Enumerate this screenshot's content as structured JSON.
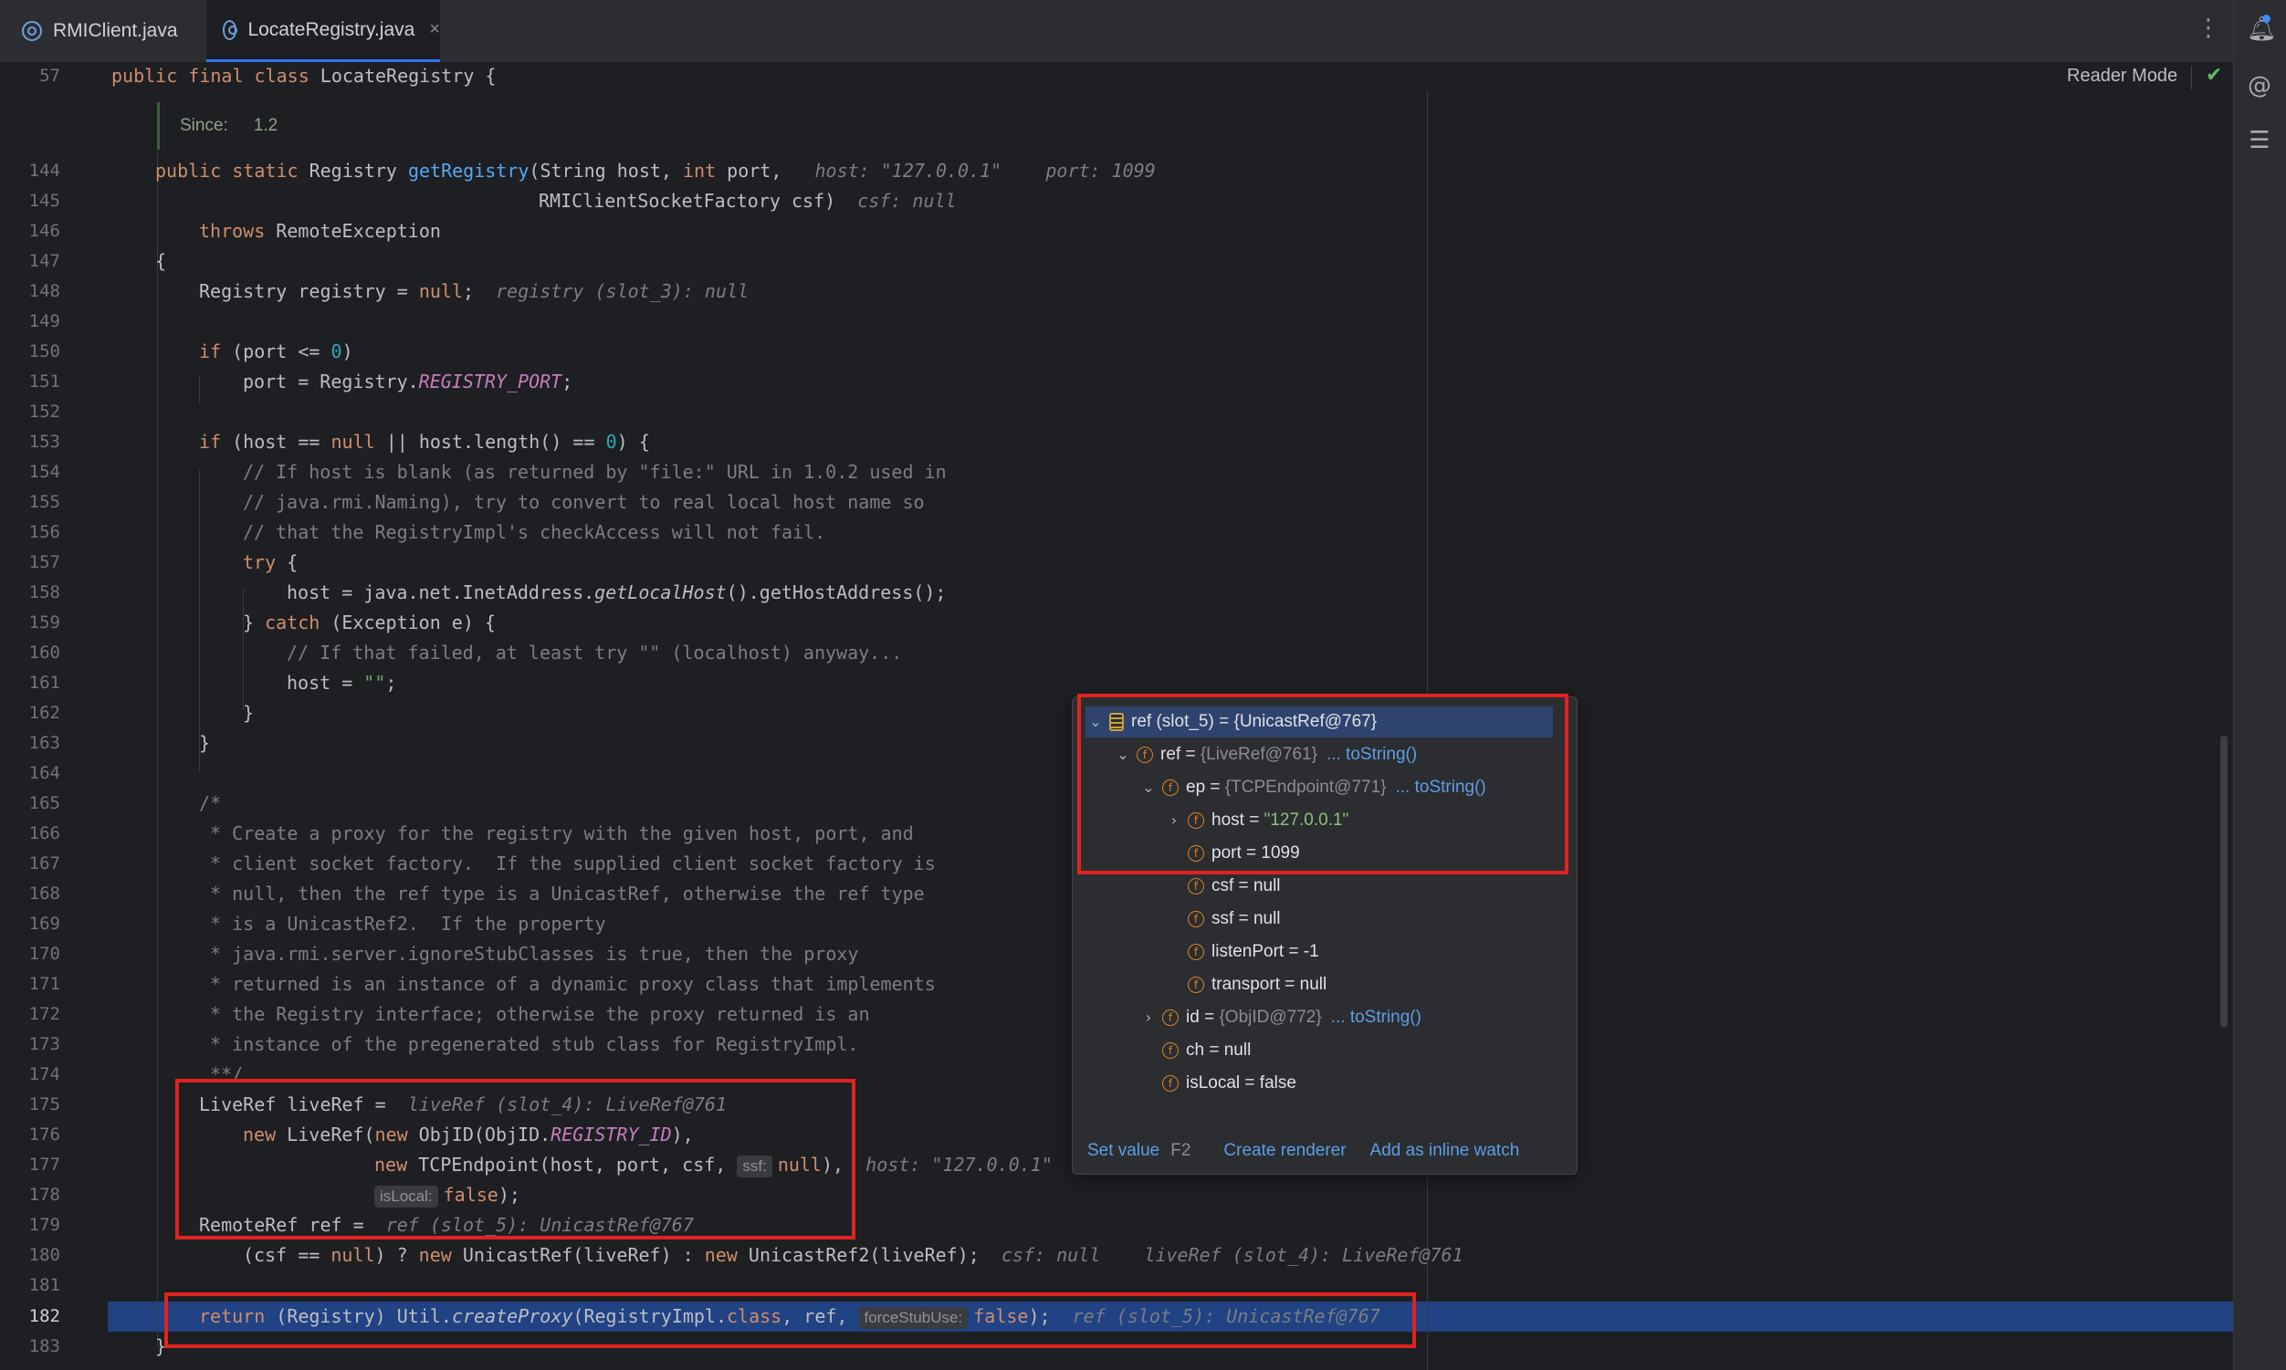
{
  "tabs": [
    {
      "label": "RMIClient.java",
      "active": false
    },
    {
      "label": "LocateRegistry.java",
      "active": true
    }
  ],
  "tab_close_glyph": "×",
  "reader_mode": "Reader Mode",
  "doc": {
    "since_label": "Since:",
    "since_value": "1.2"
  },
  "line_numbers": [
    "57",
    "144",
    "145",
    "146",
    "147",
    "148",
    "149",
    "150",
    "151",
    "152",
    "153",
    "154",
    "155",
    "156",
    "157",
    "158",
    "159",
    "160",
    "161",
    "162",
    "163",
    "164",
    "165",
    "166",
    "167",
    "168",
    "169",
    "170",
    "171",
    "172",
    "173",
    "174",
    "175",
    "176",
    "177",
    "178",
    "179",
    "180",
    "181",
    "182",
    "183"
  ],
  "current_line": "182",
  "code": {
    "l57": [
      "public final class",
      " LocateRegistry {"
    ],
    "l144": [
      "public static",
      " Registry ",
      "getRegistry",
      "(String host, ",
      "int",
      " port,",
      "host: \"127.0.0.1\"",
      "port: 1099"
    ],
    "l145": [
      "RMIClientSocketFactory csf)",
      "csf: null"
    ],
    "l146": [
      "throws",
      " RemoteException"
    ],
    "l147": "{",
    "l148": [
      "Registry registry = ",
      "null",
      ";",
      "registry (slot_3): null"
    ],
    "l150": [
      "if",
      " (port <= ",
      "0",
      ")"
    ],
    "l151": [
      "port = Registry.",
      "REGISTRY_PORT",
      ";"
    ],
    "l153": [
      "if",
      " (host == ",
      "null",
      " || host.length() == ",
      "0",
      ") {"
    ],
    "l154": "// If host is blank (as returned by \"file:\" URL in 1.0.2 used in",
    "l155": "// java.rmi.Naming), try to convert to real local host name so",
    "l156": "// that the RegistryImpl's checkAccess will not fail.",
    "l157": [
      "try",
      " {"
    ],
    "l158": [
      "host = java.net.InetAddress.",
      "getLocalHost",
      "().getHostAddress();"
    ],
    "l159": [
      "} ",
      "catch",
      " (Exception e) {"
    ],
    "l160": "// If that failed, at least try \"\" (localhost) anyway...",
    "l161": [
      "host = ",
      "\"\"",
      ";"
    ],
    "l162": "}",
    "l163": "}",
    "l165": "/*",
    "l166": " * Create a proxy for the registry with the given host, port, and",
    "l167": " * client socket factory.  If the supplied client socket factory is",
    "l168": " * null, then the ref type is a UnicastRef, otherwise the ref type",
    "l169": " * is a UnicastRef2.  If the property",
    "l170": " * java.rmi.server.ignoreStubClasses is true, then the proxy",
    "l171": " * returned is an instance of a dynamic proxy class that implements",
    "l172": " * the Registry interface; otherwise the proxy returned is an",
    "l173": " * instance of the pregenerated stub class for RegistryImpl.",
    "l174": " **/",
    "l175": [
      "LiveRef liveRef =",
      "liveRef (slot_4): LiveRef@761"
    ],
    "l176": [
      "new",
      " LiveRef(",
      "new",
      " ObjID(ObjID.",
      "REGISTRY_ID",
      "),"
    ],
    "l177": [
      "new",
      " TCPEndpoint(host, port, csf, ",
      "ssf:",
      "null",
      "),",
      "host: \"127.0.0.1\""
    ],
    "l178": [
      "isLocal:",
      "false",
      ");"
    ],
    "l179": [
      "RemoteRef ref =",
      "ref (slot_5): UnicastRef@767"
    ],
    "l180": [
      "(csf == ",
      "null",
      ") ? ",
      "new",
      " UnicastRef(liveRef) : ",
      "new",
      " UnicastRef2(liveRef);",
      "csf: null",
      "liveRef (slot_4): LiveRef@761"
    ],
    "l182": [
      "return",
      " (Registry) Util.",
      "createProxy",
      "(RegistryImpl.",
      "class",
      ", ref, ",
      "forceStubUse:",
      "false",
      ");",
      "ref (slot_5): UnicastRef@767"
    ],
    "l183": "}"
  },
  "popup": {
    "rows": [
      {
        "arrow": "⌄",
        "icon": "struct",
        "name": "ref (slot_5) = ",
        "value": "{UnicastRef@767}"
      },
      {
        "arrow": "⌄",
        "icon": "f",
        "name": "ref = ",
        "value": "{LiveRef@761}",
        "link": "... toString()"
      },
      {
        "arrow": "⌄",
        "icon": "f",
        "name": "ep = ",
        "value": "{TCPEndpoint@771}",
        "link": "... toString()"
      },
      {
        "arrow": "›",
        "icon": "f",
        "name": "host = ",
        "value": "\"127.0.0.1\""
      },
      {
        "arrow": "",
        "icon": "f",
        "name": "port = ",
        "value": "1099"
      },
      {
        "arrow": "",
        "icon": "f",
        "name": "csf = ",
        "value": "null"
      },
      {
        "arrow": "",
        "icon": "f",
        "name": "ssf = ",
        "value": "null"
      },
      {
        "arrow": "",
        "icon": "f",
        "name": "listenPort = ",
        "value": "-1"
      },
      {
        "arrow": "",
        "icon": "f",
        "name": "transport = ",
        "value": "null"
      },
      {
        "arrow": "›",
        "icon": "f",
        "name": "id = ",
        "value": "{ObjID@772}",
        "link": "... toString()"
      },
      {
        "arrow": "",
        "icon": "f",
        "name": "ch = ",
        "value": "null"
      },
      {
        "arrow": "",
        "icon": "f",
        "name": "isLocal = ",
        "value": "false"
      }
    ],
    "footer": {
      "set_value": "Set value",
      "set_value_key": "F2",
      "create_renderer": "Create renderer",
      "add_inline_watch": "Add as inline watch"
    }
  },
  "colors": {
    "accent": "#3574f0",
    "highlight_line": "#214283",
    "annotation_box": "#e0231f"
  },
  "icons": [
    "kebab-menu-icon",
    "notifications-icon",
    "ai-assistant-icon",
    "database-icon",
    "check-icon"
  ]
}
